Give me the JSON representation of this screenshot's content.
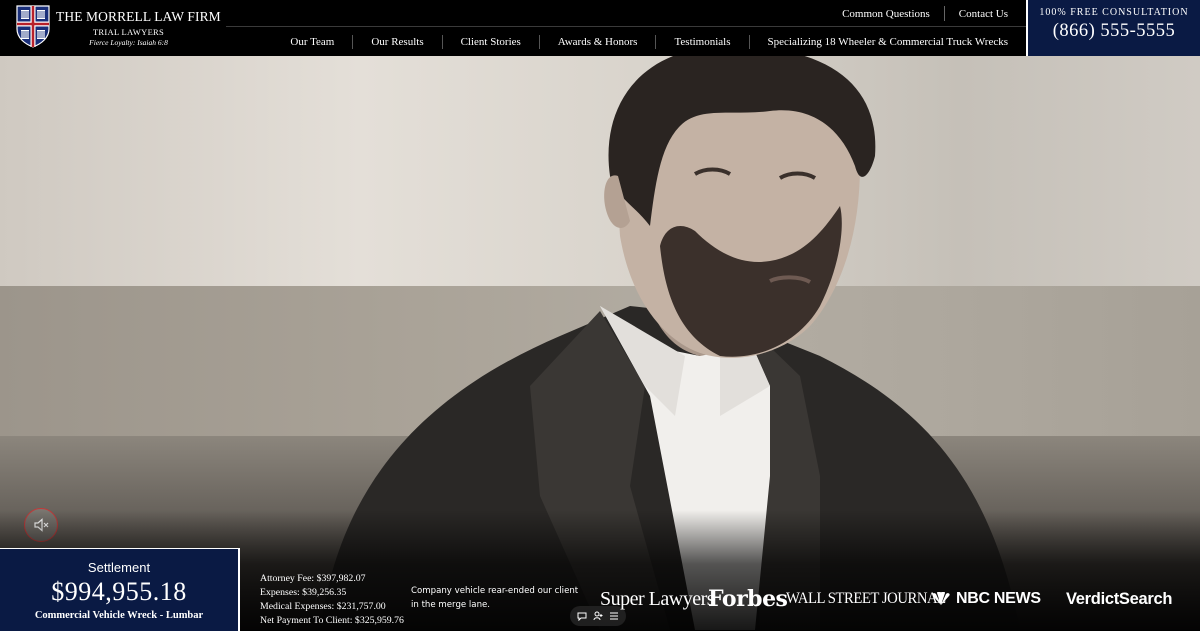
{
  "header": {
    "brand_name": "THE MORRELL LAW FIRM",
    "brand_sub": "TRIAL LAWYERS",
    "brand_tagline": "Fierce Loyalty: Isaiah 6:8",
    "top_links": [
      "Common Questions",
      "Contact Us"
    ],
    "nav": [
      "Our Team",
      "Our Results",
      "Client Stories",
      "Awards & Honors",
      "Testimonials",
      "Specializing 18 Wheeler & Commercial Truck Wrecks"
    ],
    "consultation_label": "100% FREE CONSULTATION",
    "phone": "(866) 555-5555"
  },
  "hero": {
    "mute_icon": "speaker-muted-icon"
  },
  "settlement": {
    "label": "Settlement",
    "amount": "$994,955.18",
    "case_type": "Commercial Vehicle Wreck - Lumbar",
    "fees": [
      "Attorney Fee: $397,982.07",
      "Expenses: $39,256.35",
      "Medical Expenses: $231,757.00",
      "Net Payment To Client: $325,959.76"
    ],
    "description_lines": [
      "Company vehicle rear-ended our client",
      "in the merge lane."
    ]
  },
  "badges": {
    "super_lawyers": "Super Lawyers",
    "forbes": "Forbes",
    "wsj": "WALL STREET JOURNAL",
    "nbc": "NBC NEWS",
    "verdict": "VerdictSearch"
  },
  "colors": {
    "navy": "#0a1a44",
    "header_bg": "#000000",
    "mute_ring": "#c23a3a"
  }
}
